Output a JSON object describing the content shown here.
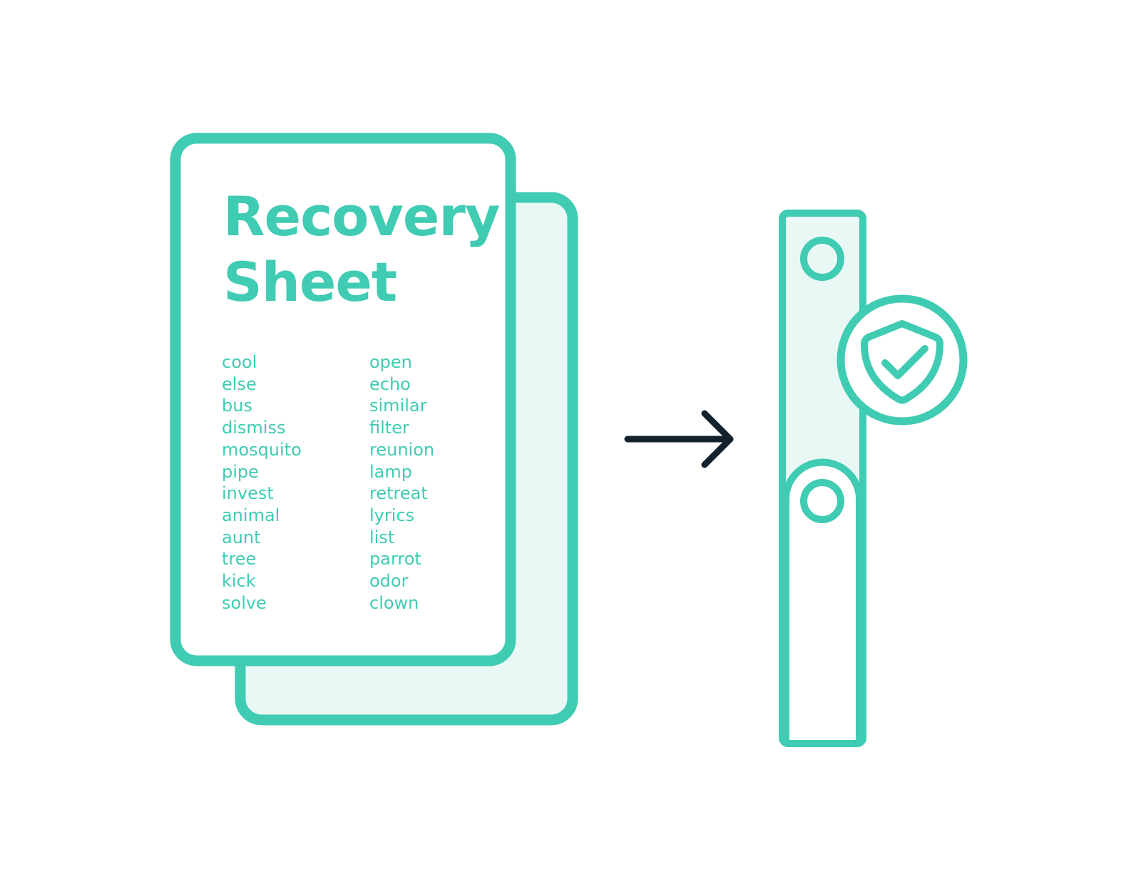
{
  "sheet": {
    "title_line1": "Recovery",
    "title_line2": "Sheet",
    "words_col1": [
      "cool",
      "else",
      "bus",
      "dismiss",
      "mosquito",
      "pipe",
      "invest",
      "animal",
      "aunt",
      "tree",
      "kick",
      "solve"
    ],
    "words_col2": [
      "open",
      "echo",
      "similar",
      "filter",
      "reunion",
      "lamp",
      "retreat",
      "lyrics",
      "list",
      "parrot",
      "odor",
      "clown"
    ]
  },
  "icons": {
    "arrow": "arrow-right-icon",
    "device": "hardware-wallet-icon",
    "shield": "shield-check-icon"
  },
  "colors": {
    "accent": "#40cbb3",
    "accent_light": "#eaf8f5",
    "arrow": "#14222e",
    "background": "#ffffff"
  }
}
